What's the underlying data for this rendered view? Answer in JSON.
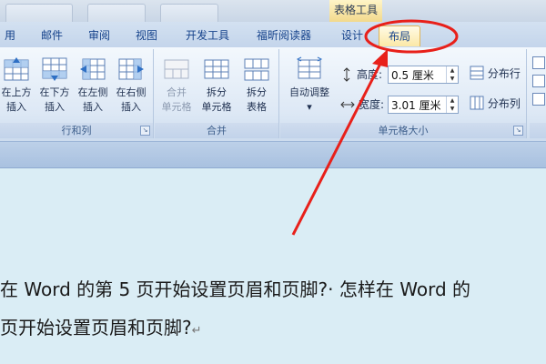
{
  "title_strip": {
    "context_title": "表格工具"
  },
  "tabs": [
    {
      "label": "用"
    },
    {
      "label": "邮件"
    },
    {
      "label": "审阅"
    },
    {
      "label": "视图"
    },
    {
      "label": "开发工具"
    },
    {
      "label": "福昕阅读器"
    },
    {
      "label": "设计"
    },
    {
      "label": "布局"
    }
  ],
  "ribbon": {
    "rows_cols": {
      "label": "行和列",
      "buttons": [
        {
          "line1": "在上方",
          "line2": "插入"
        },
        {
          "line1": "在下方",
          "line2": "插入"
        },
        {
          "line1": "在左侧",
          "line2": "插入"
        },
        {
          "line1": "在右侧",
          "line2": "插入"
        }
      ]
    },
    "merge": {
      "label": "合并",
      "buttons": [
        {
          "line1": "合并",
          "line2": "单元格"
        },
        {
          "line1": "拆分",
          "line2": "单元格"
        },
        {
          "line1": "拆分",
          "line2": "表格"
        }
      ]
    },
    "cell_size": {
      "label": "单元格大小",
      "autofit": "自动调整",
      "height_label": "高度:",
      "height_value": "0.5 厘米",
      "width_label": "宽度:",
      "width_value": "3.01 厘米",
      "distribute_rows": "分布行",
      "distribute_cols": "分布列"
    }
  },
  "document": {
    "line1": "在 Word 的第 5 页开始设置页眉和页脚?· 怎样在 Word 的",
    "line2": "页开始设置页眉和页脚?",
    "paragraph_mark": "↵"
  },
  "colors": {
    "annotation": "#e8201a",
    "active_tab": "#fbe8a6"
  }
}
